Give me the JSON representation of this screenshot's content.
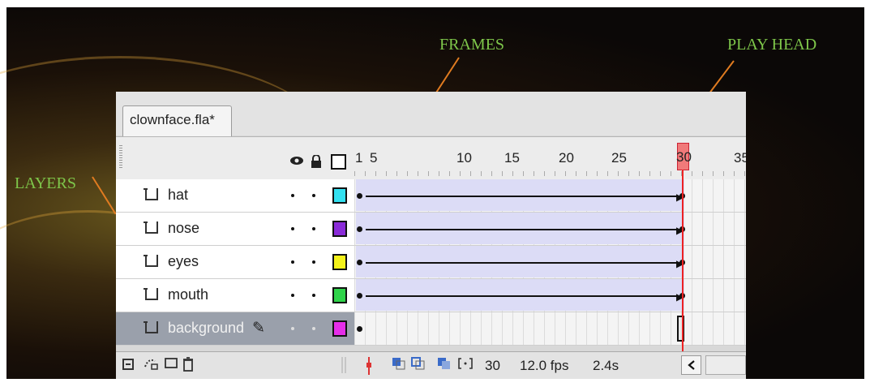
{
  "annotations": {
    "frames": "FRAMES",
    "play_head": "PLAY HEAD",
    "layers": "LAYERS"
  },
  "document_tab": "clownface.fla*",
  "frame_ruler": [
    "1",
    "5",
    "10",
    "15",
    "20",
    "25",
    "30",
    "35"
  ],
  "playhead_frame": "30",
  "layers": [
    {
      "name": "hat",
      "color": "#33e0f0",
      "selected": false
    },
    {
      "name": "nose",
      "color": "#8a2bd8",
      "selected": false
    },
    {
      "name": "eyes",
      "color": "#f4f21a",
      "selected": false
    },
    {
      "name": "mouth",
      "color": "#2fd34a",
      "selected": false
    },
    {
      "name": "background",
      "color": "#e52ee8",
      "selected": true
    }
  ],
  "status": {
    "current_frame": "30",
    "frame_rate": "12.0 fps",
    "elapsed": "2.4s"
  },
  "icons": {
    "eye": "eye-icon",
    "lock": "lock-icon",
    "outline": "outline-icon",
    "new_layer": "new-layer-icon",
    "motion_guide": "motion-guide-icon",
    "folder": "folder-icon",
    "trash": "trash-icon",
    "pencil": "pencil-icon",
    "scroll_left": "chevron-left-icon"
  }
}
